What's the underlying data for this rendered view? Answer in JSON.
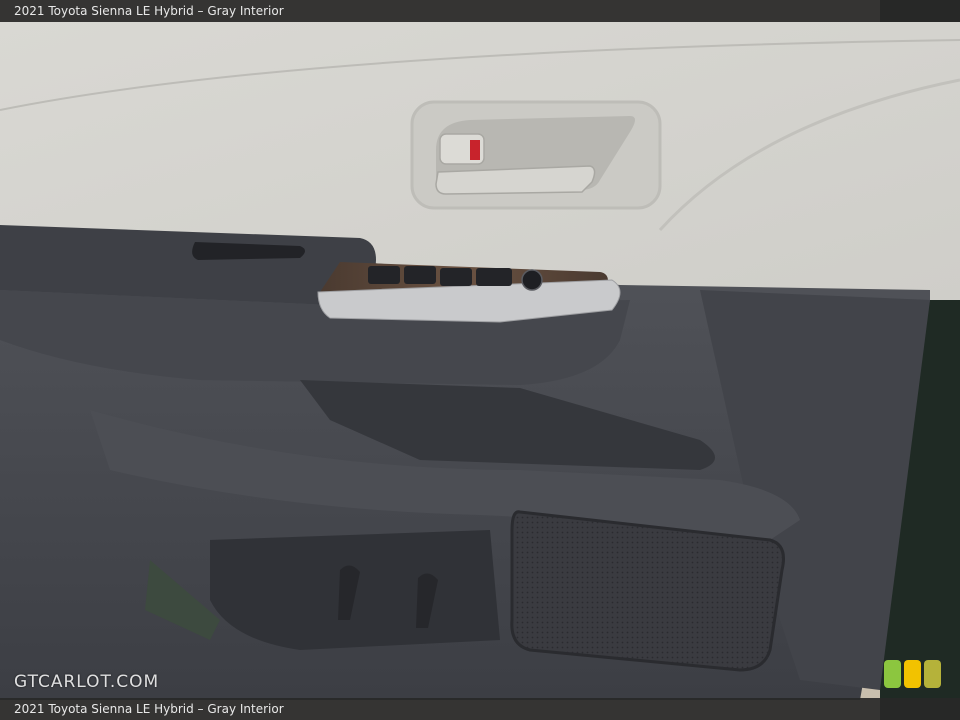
{
  "caption_top": "2021 Toyota Sienna LE Hybrid – Gray Interior",
  "caption_bottom": "2021 Toyota Sienna LE Hybrid – Gray Interior",
  "watermark": "GTCARLOT.COM",
  "colors": {
    "upper_panel": "#d6d5d0",
    "lower_panel": "#4a4c52",
    "armrest": "#3e4046",
    "chrome": "#c9cacc",
    "ground": "#c9bfae",
    "badge_green": "#8cc63f",
    "badge_yellow": "#f2c200",
    "badge_olive": "#b5b23a"
  }
}
